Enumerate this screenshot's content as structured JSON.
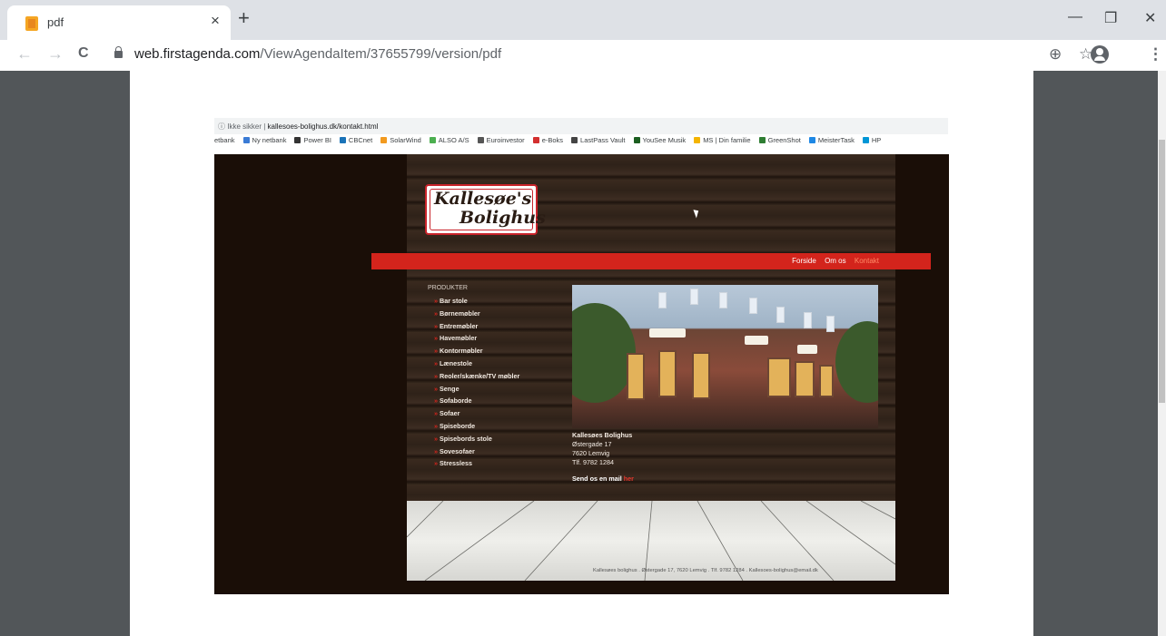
{
  "browser": {
    "tab_title": "pdf",
    "tab_close": "×",
    "new_tab": "+",
    "url_domain": "web.firstagenda.com",
    "url_path": "/ViewAgendaItem/37655799/version/pdf",
    "back_icon": "←",
    "forward_icon": "→",
    "reload_icon": "C",
    "zoom_icon": "⊕",
    "star_icon": "☆",
    "menu_icon": "⋮",
    "minimize": "—",
    "restore": "❐",
    "close": "✕"
  },
  "embedded_browser": {
    "security_label": "ⓘ Ikke sikker",
    "url": "kallesoes-bolighus.dk/kontakt.html",
    "bookmarks": [
      {
        "label": "etbank",
        "color": ""
      },
      {
        "label": "Ny netbank",
        "color": "#3a7bd5"
      },
      {
        "label": "Power BI",
        "color": "#333333"
      },
      {
        "label": "CBCnet",
        "color": "#1a73b8"
      },
      {
        "label": "SolarWind",
        "color": "#f29a1f"
      },
      {
        "label": "ALSO A/S",
        "color": "#4caf50"
      },
      {
        "label": "Euroinvestor",
        "color": "#555555"
      },
      {
        "label": "e-Boks",
        "color": "#d32f2f"
      },
      {
        "label": "LastPass Vault",
        "color": "#444444"
      },
      {
        "label": "YouSee Musik",
        "color": "#1b5e20"
      },
      {
        "label": "MS | Din familie",
        "color": "#f4b400"
      },
      {
        "label": "GreenShot",
        "color": "#2e7d32"
      },
      {
        "label": "MeisterTask",
        "color": "#1e88e5"
      },
      {
        "label": "HP",
        "color": "#0096d6"
      }
    ]
  },
  "site": {
    "logo_line1": "Kallesøe's",
    "logo_line2": "Bolighus",
    "nav": [
      "Forside",
      "Om os",
      "Kontakt"
    ],
    "categories_title": "PRODUKTER",
    "categories": [
      "Bar stole",
      "Børnemøbler",
      "Entremøbler",
      "Havemøbler",
      "Kontormøbler",
      "Lænestole",
      "Reoler/skænke/TV møbler",
      "Senge",
      "Sofaborde",
      "Sofaer",
      "Spiseborde",
      "Spisebords stole",
      "Sovesofaer",
      "Stressless"
    ],
    "company": "Kallesøes Bolighus",
    "street": "Østergade 17",
    "city": "7620 Lemvig",
    "phone": "Tlf. 9782 1284",
    "mail_text": "Send os en mail",
    "mail_link": "her",
    "footer": "Kallesøes bolighus . Østergade 17, 7620 Lemvig . Tlf. 9782 1284 . Kallesoes-bolighus@email.dk"
  }
}
